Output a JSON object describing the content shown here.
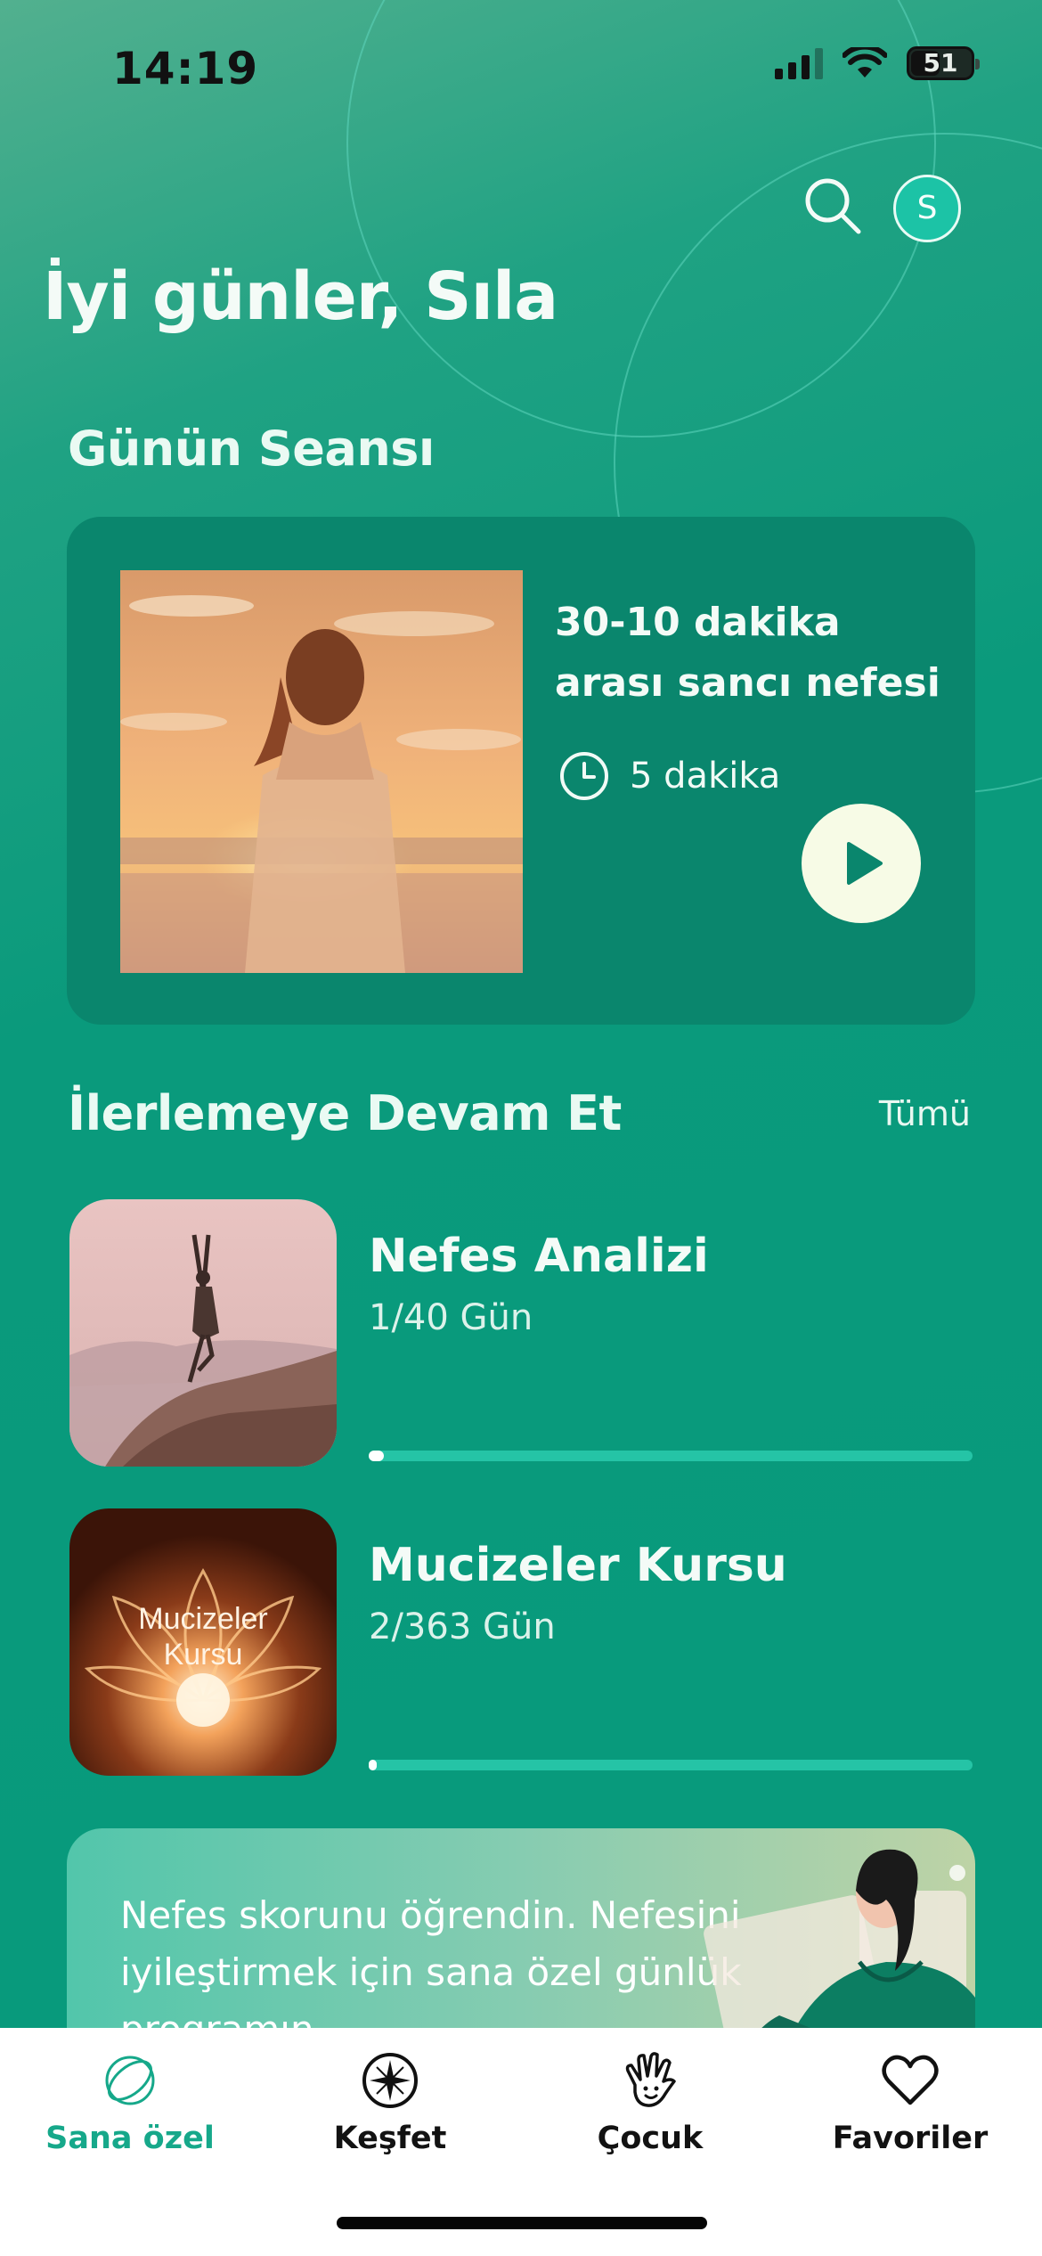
{
  "status_bar": {
    "time": "14:19",
    "battery": "51"
  },
  "header": {
    "greeting": "İyi günler, Sıla",
    "avatar_initial": "S",
    "search_icon": "search-icon"
  },
  "daily_session": {
    "section_title": "Günün Seansı",
    "title": "30-10 dakika arası sancı nefesi",
    "duration": "5 dakika"
  },
  "continue_progress": {
    "section_title": "İlerlemeye Devam Et",
    "see_all": "Tümü",
    "items": [
      {
        "title": "Nefes Analizi",
        "progress_text": "1/40 Gün",
        "progress": 0.025,
        "thumb_caption": ""
      },
      {
        "title": "Mucizeler Kursu",
        "progress_text": "2/363 Gün",
        "progress": 0.0055,
        "thumb_caption": "Mucizeler Kursu"
      }
    ]
  },
  "promo": {
    "text": "Nefes skorunu öğrendin. Nefesini iyileştirmek için sana özel günlük programın"
  },
  "tabbar": {
    "active": "Sana özel",
    "tabs": [
      {
        "label": "Sana özel",
        "icon": "rings-icon"
      },
      {
        "label": "Keşfet",
        "icon": "compass-icon"
      },
      {
        "label": "Çocuk",
        "icon": "hand-icon"
      },
      {
        "label": "Favoriler",
        "icon": "heart-icon"
      }
    ]
  },
  "colors": {
    "background": "#079a7c",
    "card": "#0a866d",
    "accent": "#16a88a",
    "play_button": "#f7fbe6"
  }
}
